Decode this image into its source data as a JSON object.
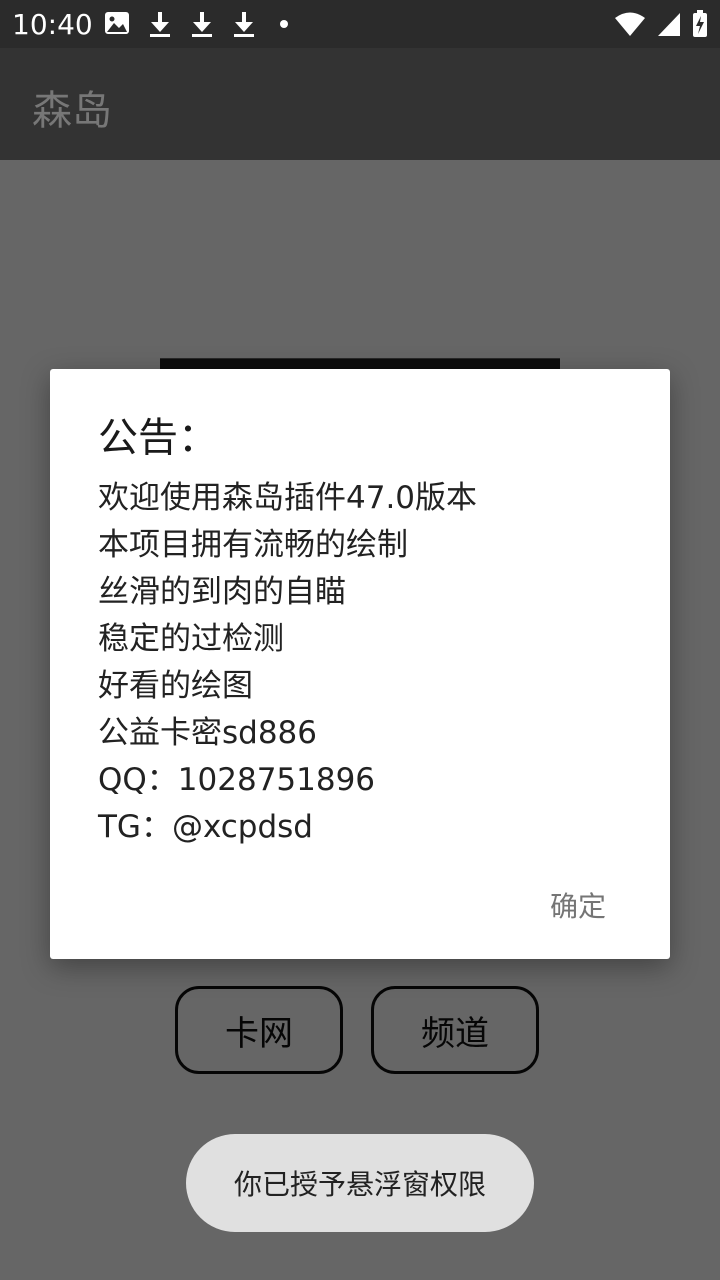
{
  "status_bar": {
    "time": "10:40",
    "left_icons": [
      "image-icon",
      "download-icon",
      "download-icon",
      "download-icon",
      "dot-icon"
    ],
    "right_icons": [
      "wifi-icon",
      "signal-icon",
      "battery-charging-icon"
    ]
  },
  "app_bar": {
    "title": "森岛"
  },
  "main": {
    "buttons": [
      {
        "label": "卡网"
      },
      {
        "label": "频道"
      }
    ]
  },
  "dialog": {
    "title": "公告：",
    "lines": [
      "欢迎使用森岛插件47.0版本",
      "本项目拥有流畅的绘制",
      "丝滑的到肉的自瞄",
      "稳定的过检测",
      "好看的绘图",
      "公益卡密sd886",
      "QQ：1028751896",
      "TG：@xcpdsd"
    ],
    "confirm_label": "确定"
  },
  "toast": {
    "text": "你已授予悬浮窗权限"
  },
  "colors": {
    "scrim": "#000000",
    "status_bar": "#2b2b2b",
    "app_bar": "#333333",
    "toast": "#e0e0e0"
  }
}
